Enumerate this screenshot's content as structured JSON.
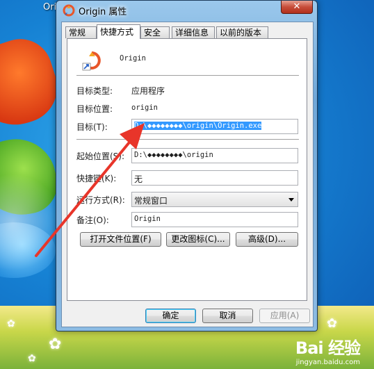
{
  "desktop": {
    "partial_icon_label": "Ori"
  },
  "window": {
    "title": "Origin 属性",
    "close_symbol": "✕"
  },
  "tabs": [
    {
      "label": "常规"
    },
    {
      "label": "快捷方式"
    },
    {
      "label": "安全"
    },
    {
      "label": "详细信息"
    },
    {
      "label": "以前的版本"
    }
  ],
  "active_tab": "快捷方式",
  "shortcut": {
    "name": "Origin",
    "target_type_label": "目标类型:",
    "target_type_value": "应用程序",
    "target_location_label": "目标位置:",
    "target_location_value": "origin",
    "target_label": "目标(T):",
    "target_value": "D:\\◆◆◆◆◆◆◆◆\\origin\\Origin.exe",
    "start_in_label": "起始位置(S):",
    "start_in_value": "D:\\◆◆◆◆◆◆◆◆\\origin",
    "hotkey_label": "快捷键(K):",
    "hotkey_value": "无",
    "run_label": "运行方式(R):",
    "run_value": "常规窗口",
    "comment_label": "备注(O):",
    "comment_value": "Origin"
  },
  "buttons": {
    "open_location": "打开文件位置(F)",
    "change_icon": "更改图标(C)...",
    "advanced": "高级(D)...",
    "ok": "确定",
    "cancel": "取消",
    "apply": "应用(A)"
  },
  "watermark": {
    "logo": "Bai  经验",
    "url": "jingyan.baidu.com"
  },
  "colors": {
    "selection": "#3399ff",
    "annotation_arrow": "#e8352a",
    "window_frame": "#6fa7d8"
  }
}
